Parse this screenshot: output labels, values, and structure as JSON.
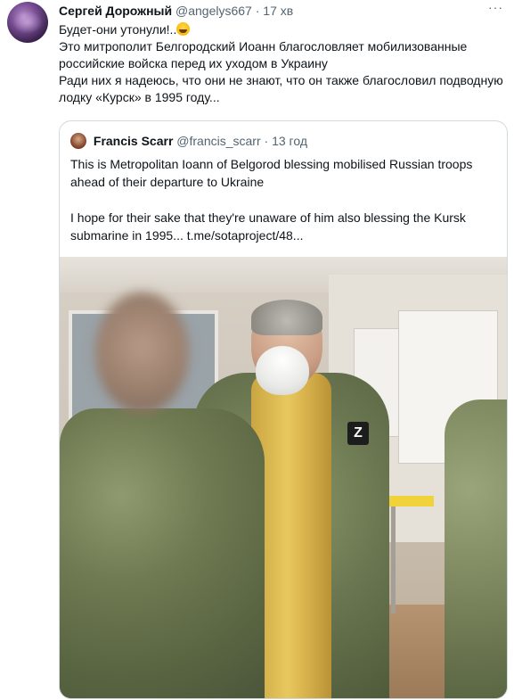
{
  "tweet": {
    "author_name": "Сергей Дорожный",
    "author_handle": "@angelys667",
    "separator": "·",
    "time": "17 хв",
    "more_label": "···",
    "lines": [
      "Будет-они утонули!..",
      "Это митрополит Белгородский Иоанн благословляет мобилизованные российские войска перед их уходом в Украину",
      "Ради них я надеюсь, что они не знают, что он также благословил подводную лодку «Курск» в 1995 году..."
    ],
    "emoji_icon": "rofl-emoji-icon"
  },
  "quoted": {
    "author_name": "Francis Scarr",
    "author_handle": "@francis_scarr",
    "separator": "·",
    "time": "13 год",
    "paragraphs": [
      "This is Metropolitan Ioann of Belgorod blessing mobilised  Russian troops ahead of their departure to Ukraine",
      "I hope for their sake that they're unaware of him also blessing the Kursk submarine in 1995... t.me/sotaproject/48..."
    ],
    "photo_patch_letter": "Z"
  }
}
